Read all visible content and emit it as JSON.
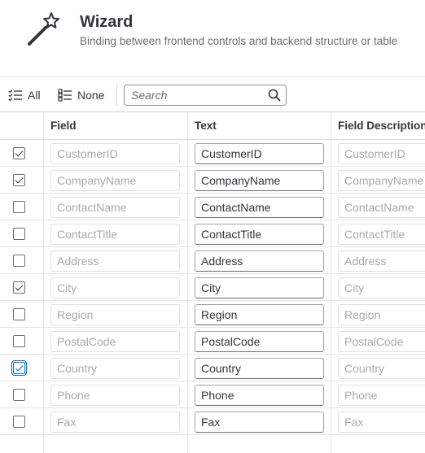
{
  "header": {
    "title": "Wizard",
    "subtitle": "Binding between frontend controls and backend structure or table"
  },
  "toolbar": {
    "all_label": "All",
    "none_label": "None",
    "search_placeholder": "Search"
  },
  "table": {
    "columns": [
      "Field",
      "Text",
      "Field Description"
    ],
    "rows": [
      {
        "checked": true,
        "field": "CustomerID",
        "text": "CustomerID",
        "description": "CustomerID"
      },
      {
        "checked": true,
        "field": "CompanyName",
        "text": "CompanyName",
        "description": "CompanyName"
      },
      {
        "checked": false,
        "field": "ContactName",
        "text": "ContactName",
        "description": "ContactName"
      },
      {
        "checked": false,
        "field": "ContactTitle",
        "text": "ContactTitle",
        "description": "ContactTitle"
      },
      {
        "checked": false,
        "field": "Address",
        "text": "Address",
        "description": "Address"
      },
      {
        "checked": true,
        "field": "City",
        "text": "City",
        "description": "City"
      },
      {
        "checked": false,
        "field": "Region",
        "text": "Region",
        "description": "Region"
      },
      {
        "checked": false,
        "field": "PostalCode",
        "text": "PostalCode",
        "description": "PostalCode"
      },
      {
        "checked": true,
        "field": "Country",
        "text": "Country",
        "description": "Country",
        "focused": true
      },
      {
        "checked": false,
        "field": "Phone",
        "text": "Phone",
        "description": "Phone"
      },
      {
        "checked": false,
        "field": "Fax",
        "text": "Fax",
        "description": "Fax"
      }
    ]
  },
  "icons": {
    "wizard": "magic-wand-icon",
    "select_all": "multi-select-all-icon",
    "select_none": "multi-select-none-icon",
    "search": "search-icon"
  },
  "colors": {
    "text": "#32363a",
    "muted": "#6a6d70",
    "focus": "#0a6ed1"
  }
}
